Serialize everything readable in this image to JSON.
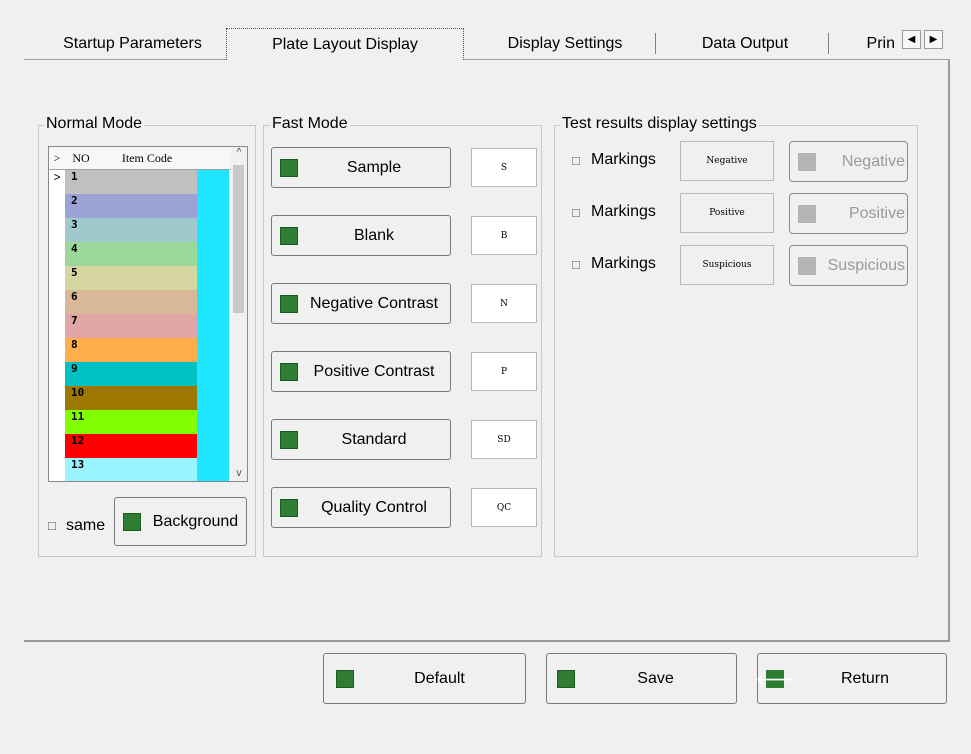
{
  "tabs": [
    {
      "label": "Startup Parameters"
    },
    {
      "label": "Plate Layout Display"
    },
    {
      "label": "Display Settings"
    },
    {
      "label": "Data Output"
    },
    {
      "label": "Prin"
    }
  ],
  "normal_mode": {
    "title": "Normal Mode",
    "grid": {
      "headers": {
        "marker": ">",
        "no": "NO",
        "item_code": "Item Code"
      },
      "current_row_marker": ">",
      "rows": [
        {
          "no": "1",
          "color": "#c0c0c0"
        },
        {
          "no": "2",
          "color": "#9ba3d4"
        },
        {
          "no": "3",
          "color": "#9fc9cc"
        },
        {
          "no": "4",
          "color": "#9cd89c"
        },
        {
          "no": "5",
          "color": "#d6d6a0"
        },
        {
          "no": "6",
          "color": "#d8b896"
        },
        {
          "no": "7",
          "color": "#e0a6a6"
        },
        {
          "no": "8",
          "color": "#ffad4d"
        },
        {
          "no": "9",
          "color": "#00c2c2"
        },
        {
          "no": "10",
          "color": "#9c7800"
        },
        {
          "no": "11",
          "color": "#80ff00"
        },
        {
          "no": "12",
          "color": "#ff0000"
        },
        {
          "no": "13",
          "color": "#9af5ff"
        }
      ],
      "extra_column_color": "#1ee6ff"
    },
    "same_label": "same",
    "background_label": "Background"
  },
  "fast_mode": {
    "title": "Fast Mode",
    "items": [
      {
        "label": "Sample",
        "code": "S"
      },
      {
        "label": "Blank",
        "code": "B"
      },
      {
        "label": "Negative Contrast",
        "code": "N"
      },
      {
        "label": "Positive Contrast",
        "code": "P"
      },
      {
        "label": "Standard",
        "code": "SD"
      },
      {
        "label": "Quality Control",
        "code": "QC"
      }
    ]
  },
  "test_results": {
    "title": "Test results display settings",
    "rows": [
      {
        "check_label": "Markings",
        "mark_text": "Negative",
        "button_label": "Negative"
      },
      {
        "check_label": "Markings",
        "mark_text": "Positive",
        "button_label": "Positive"
      },
      {
        "check_label": "Markings",
        "mark_text": "Suspicious",
        "button_label": "Suspicious"
      }
    ]
  },
  "bottom": {
    "default_label": "Default",
    "save_label": "Save",
    "return_label": "Return"
  },
  "colors": {
    "accent_green": "#2e7d32",
    "disabled_gray": "#b4b4b4"
  },
  "icons": {
    "tab_left": "◀",
    "tab_right": "▶",
    "scroll_up": "^",
    "scroll_down": "v",
    "checkbox": "□",
    "return_arrow": "🡐"
  }
}
